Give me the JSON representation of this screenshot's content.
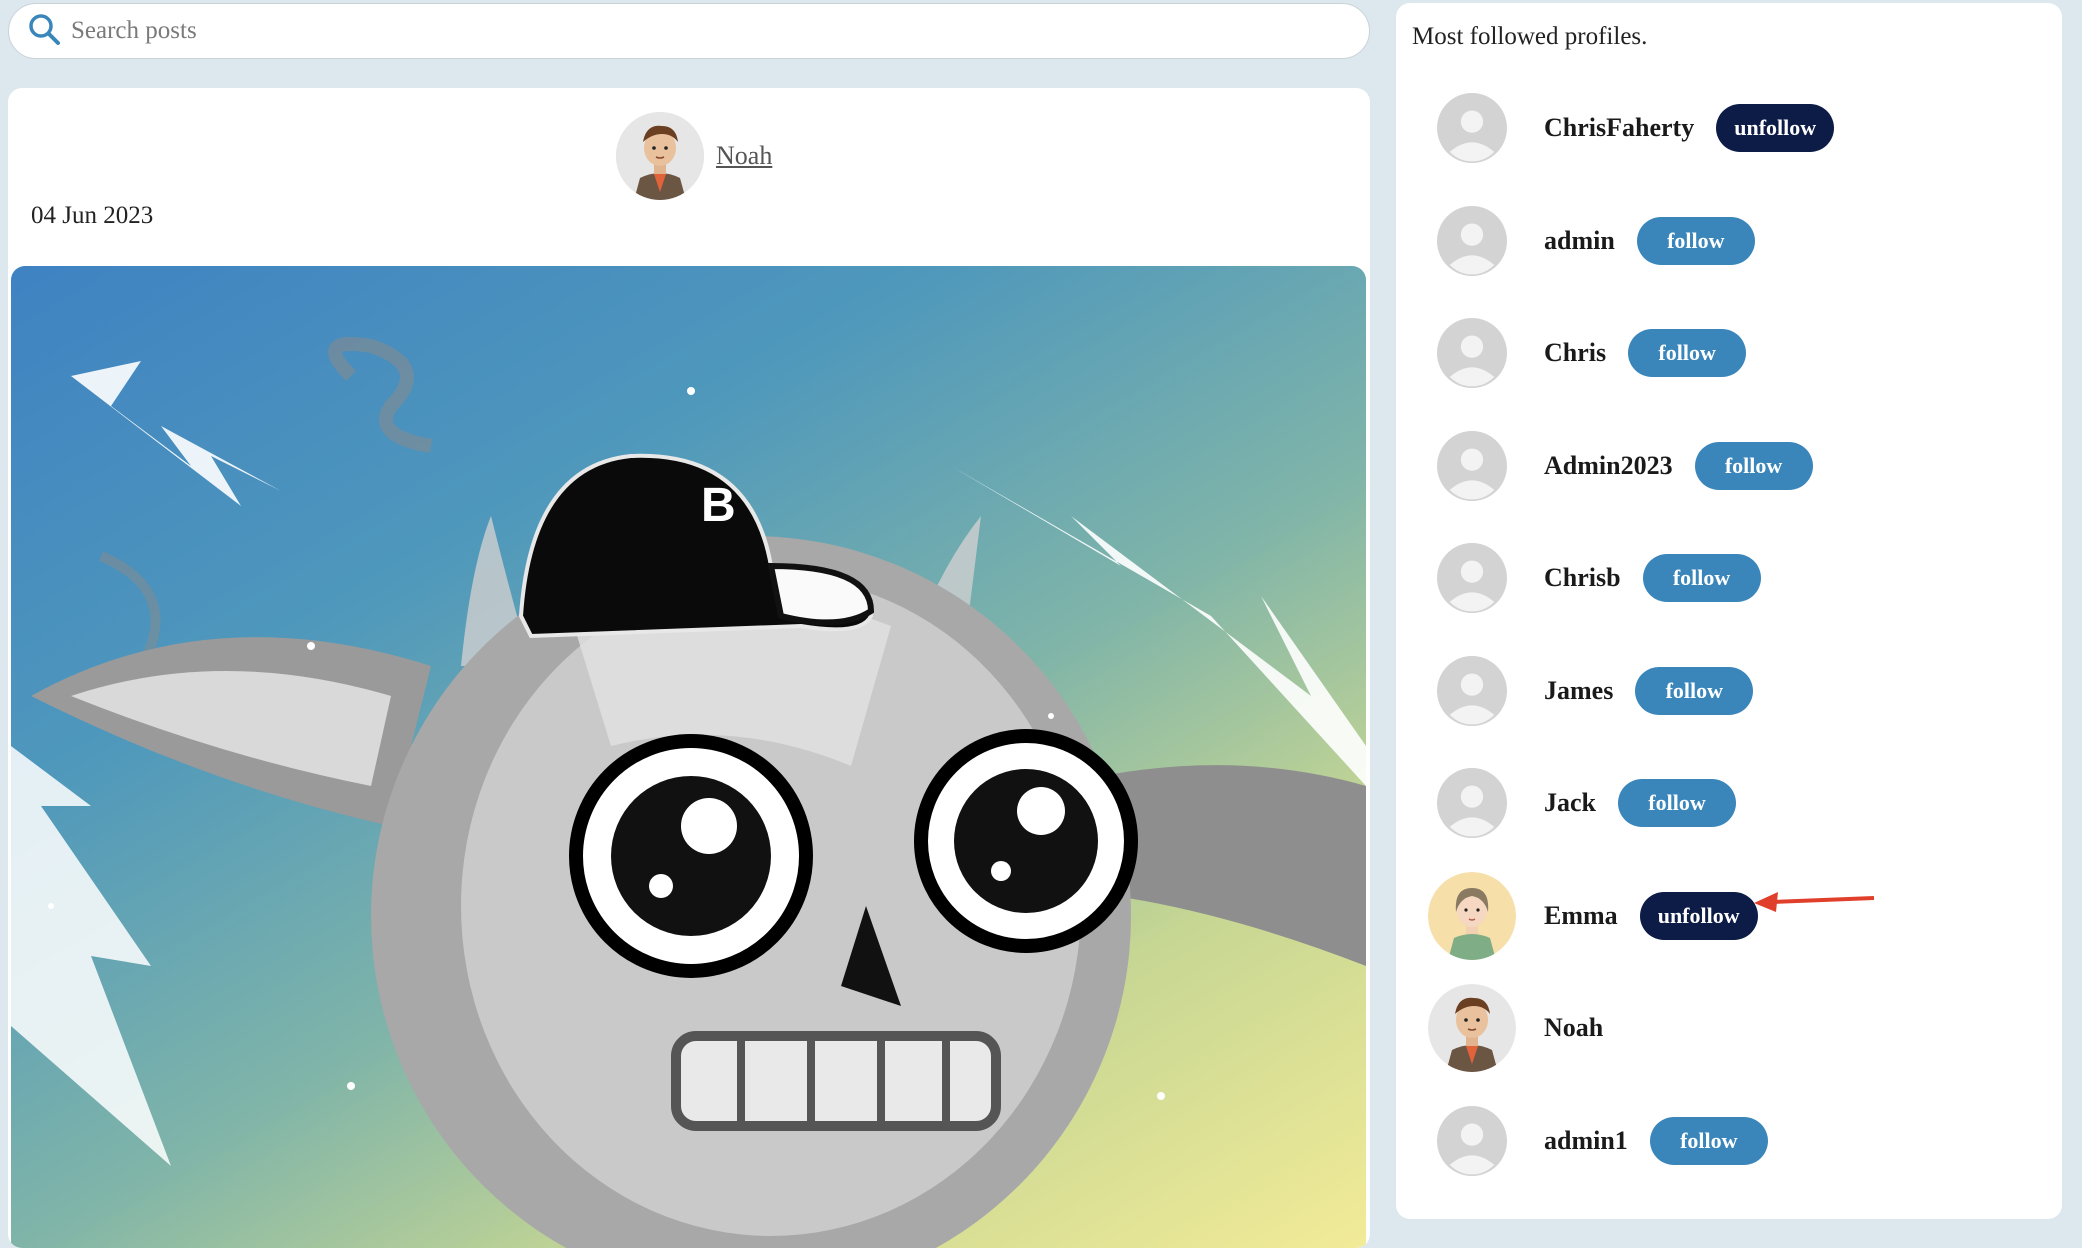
{
  "search": {
    "placeholder": "Search posts"
  },
  "post": {
    "author": "Noah",
    "date": "04 Jun 2023",
    "image_letter": "B"
  },
  "sidebar": {
    "title": "Most followed profiles.",
    "profiles": [
      {
        "name": "ChrisFaherty",
        "button": "unfollow",
        "avatar": "default-avatar"
      },
      {
        "name": "admin",
        "button": "follow",
        "avatar": "default-avatar"
      },
      {
        "name": "Chris",
        "button": "follow",
        "avatar": "default-avatar"
      },
      {
        "name": "Admin2023",
        "button": "follow",
        "avatar": "default-avatar"
      },
      {
        "name": "Chrisb",
        "button": "follow",
        "avatar": "default-avatar"
      },
      {
        "name": "James",
        "button": "follow",
        "avatar": "default-avatar"
      },
      {
        "name": "Jack",
        "button": "follow",
        "avatar": "default-avatar"
      },
      {
        "name": "Emma",
        "button": "unfollow",
        "avatar": "emma-avatar"
      },
      {
        "name": "Noah",
        "button": "",
        "avatar": "noah-avatar"
      },
      {
        "name": "admin1",
        "button": "follow",
        "avatar": "default-avatar"
      }
    ]
  },
  "colors": {
    "follow": "#3a86bb",
    "unfollow": "#0d1b47",
    "annotation_arrow": "#e0402b",
    "page_bg": "#dde8ee"
  }
}
